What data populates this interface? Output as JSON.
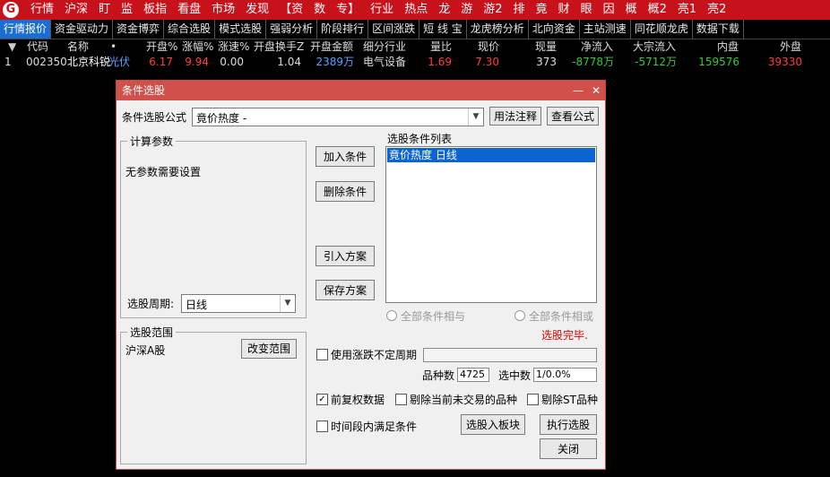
{
  "colors": {
    "brand_red": "#c8121b",
    "tab_active": "#1a6ed2",
    "price_red": "#ff3c3c",
    "price_green": "#36c836",
    "highlight": "#0a64d4"
  },
  "app": {
    "logo_icon": "brand-logo-icon",
    "logo_glyph": "G"
  },
  "menu": [
    "行情",
    "沪深",
    "盯",
    "监",
    "板指",
    "看盘",
    "市场",
    "发现",
    "【资",
    "数",
    "专】",
    "行业",
    "热点",
    "龙",
    "游",
    "游2",
    "排",
    "竟",
    "财",
    "眼",
    "因",
    "概",
    "概2",
    "亮1",
    "亮2"
  ],
  "tabs": [
    {
      "label": "行情报价",
      "active": true
    },
    {
      "label": "资金驱动力"
    },
    {
      "label": "资金博弈"
    },
    {
      "label": "综合选股"
    },
    {
      "label": "模式选股"
    },
    {
      "label": "强弱分析"
    },
    {
      "label": "阶段排行"
    },
    {
      "label": "区间涨跌"
    },
    {
      "label": "短 线 宝"
    },
    {
      "label": "龙虎榜分析"
    },
    {
      "label": "北向资金"
    },
    {
      "label": "主站测速"
    },
    {
      "label": "同花顺龙虎"
    },
    {
      "label": "数据下载"
    }
  ],
  "quote": {
    "headers": {
      "code": "代码",
      "name": "名称",
      "dot": "•",
      "open_pct": "开盘%",
      "chg_pct": "涨幅%",
      "speed": "涨速%",
      "open_turnover": "开盘换手Z",
      "open_amount": "开盘金额",
      "industry": "细分行业",
      "vol_ratio": "量比",
      "price": "现价",
      "cur_vol": "现量",
      "net_inflow": "净流入",
      "big_inflow": "大宗流入",
      "inner": "内盘",
      "outer": "外盘"
    },
    "rows": [
      {
        "idx": "1",
        "code": "002350",
        "name": "北京科锐",
        "tag": "光伏",
        "open_pct": "6.17",
        "chg_pct": "9.94",
        "speed": "0.00",
        "open_turnover": "1.04",
        "open_amount": "2389万",
        "industry": "电气设备",
        "vol_ratio": "1.69",
        "price": "7.30",
        "cur_vol": "373",
        "net_inflow": "-8778万",
        "big_inflow": "-5712万",
        "inner": "159576",
        "outer": "39330"
      }
    ]
  },
  "dialog": {
    "title": "条件选股",
    "min": "—",
    "close": "✕",
    "formula_label": "条件选股公式",
    "formula_value": "竟价热度        -",
    "usage_btn": "用法注释",
    "view_btn": "查看公式",
    "params_legend": "计算参数",
    "params_text": "无参数需要设置",
    "period_label": "选股周期:",
    "period_value": "日线",
    "scope_legend": "选股范围",
    "scope_value": "沪深A股",
    "change_scope_btn": "改变范围",
    "add_btn": "加入条件",
    "del_btn": "删除条件",
    "import_btn": "引入方案",
    "save_btn": "保存方案",
    "list_label": "选股条件列表",
    "list_items": [
      "竟价热度  日线"
    ],
    "radio_and": "全部条件相与",
    "radio_or": "全部条件相或",
    "status": "选股完毕.",
    "use_period_label": "使用涨跌不定周期",
    "count_label": "品种数",
    "count_value": "4725",
    "selected_label": "选中数",
    "selected_value": "1/0.0%",
    "adjust_label": "前复权数据",
    "exclude_untraded": "剔除当前未交易的品种",
    "exclude_st": "剔除ST品种",
    "time_cond_label": "时间段内满足条件",
    "to_block_btn": "选股入板块",
    "run_btn": "执行选股",
    "close_btn": "关闭",
    "check_glyph": "✓",
    "arrow_glyph": "▼"
  }
}
